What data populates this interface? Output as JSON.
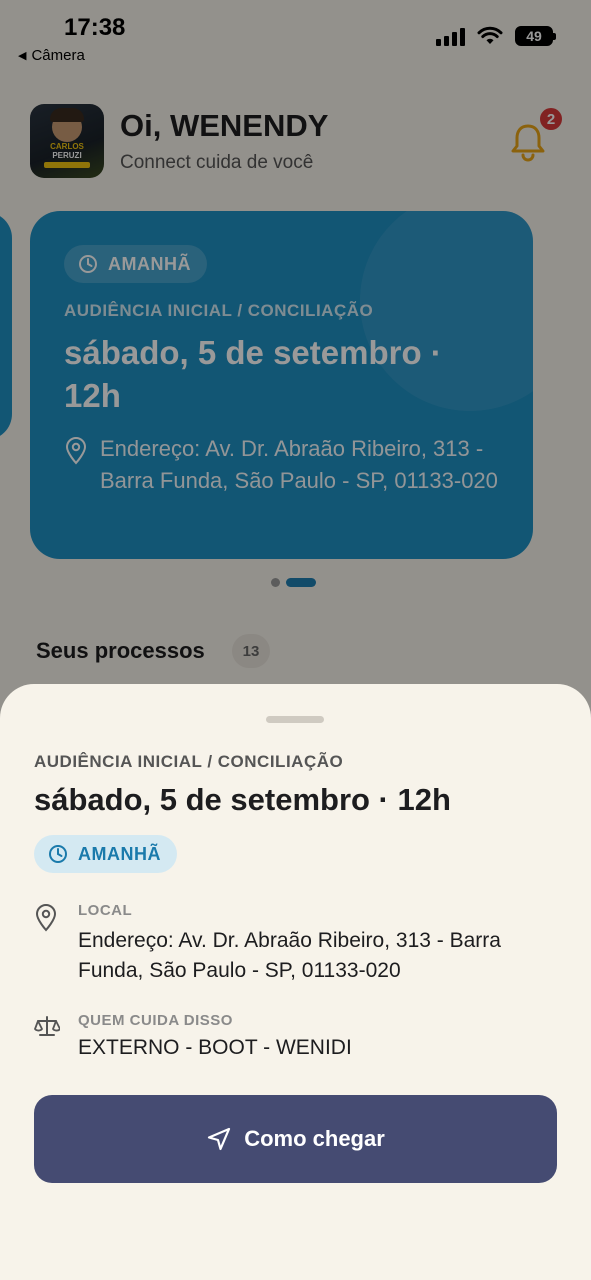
{
  "status_bar": {
    "time": "17:38",
    "back_app": "Câmera",
    "battery": "49"
  },
  "header": {
    "greeting": "Oi, WENENDY",
    "subtitle": "Connect cuida de você",
    "notifications_count": "2",
    "avatar_text_1": "CARLOS",
    "avatar_text_2": "PERUZI"
  },
  "carousel": {
    "active_index": 1,
    "card": {
      "badge": "AMANHÃ",
      "type": "AUDIÊNCIA INICIAL / CONCILIAÇÃO",
      "date": "sábado, 5 de setembro · 12h",
      "address": "Endereço: Av. Dr. Abraão Ribeiro, 313 - Barra Funda, São Paulo - SP, 01133-020"
    }
  },
  "processes": {
    "title": "Seus processos",
    "count": "13"
  },
  "sheet": {
    "type": "AUDIÊNCIA INICIAL / CONCILIAÇÃO",
    "date": "sábado, 5 de setembro · 12h",
    "badge": "AMANHÃ",
    "location_label": "LOCAL",
    "location_value": "Endereço: Av. Dr. Abraão Ribeiro, 313 - Barra Funda, São Paulo - SP, 01133-020",
    "responsible_label": "QUEM CUIDA DISSO",
    "responsible_value": "EXTERNO - BOOT - WENIDI",
    "cta_label": "Como chegar"
  },
  "colors": {
    "card": "#1f8fc2",
    "cta": "#454b72",
    "badge_text": "#1a7aab",
    "notification": "#d83a3a",
    "bell": "#e8a417"
  }
}
